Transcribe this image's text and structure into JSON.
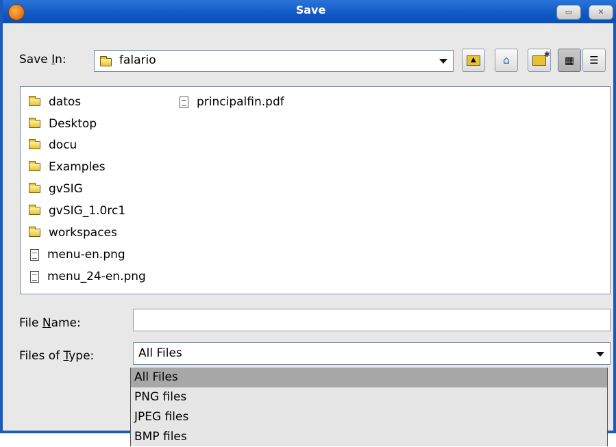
{
  "window": {
    "title": "Save",
    "min_btn": "▭",
    "close_btn": "✕"
  },
  "save_in": {
    "label_pre": "Save ",
    "label_mn": "I",
    "label_post": "n:",
    "value": "falario"
  },
  "toolbar": {
    "up_icon": "up-folder-icon",
    "home_icon": "home-icon",
    "new_folder_icon": "new-folder-icon",
    "list_view_icon": "list-view-icon",
    "details_view_icon": "details-view-icon"
  },
  "files": [
    {
      "name": "datos",
      "type": "folder"
    },
    {
      "name": "Desktop",
      "type": "folder"
    },
    {
      "name": "docu",
      "type": "folder"
    },
    {
      "name": "Examples",
      "type": "folder"
    },
    {
      "name": "gvSIG",
      "type": "folder"
    },
    {
      "name": "gvSIG_1.0rc1",
      "type": "folder"
    },
    {
      "name": "workspaces",
      "type": "folder"
    },
    {
      "name": "menu-en.png",
      "type": "file"
    },
    {
      "name": "menu_24-en.png",
      "type": "file"
    },
    {
      "name": "principalfin.pdf",
      "type": "file"
    }
  ],
  "file_name": {
    "label_pre": "File ",
    "label_mn": "N",
    "label_post": "ame:",
    "value": ""
  },
  "file_type": {
    "label_pre": "Files of ",
    "label_mn": "T",
    "label_post": "ype:",
    "value": "All Files",
    "options": [
      "All Files",
      "PNG files",
      "JPEG files",
      "BMP files"
    ]
  },
  "colors": {
    "title_bar": "#0f58c6",
    "selection": "#a7a7a7"
  }
}
